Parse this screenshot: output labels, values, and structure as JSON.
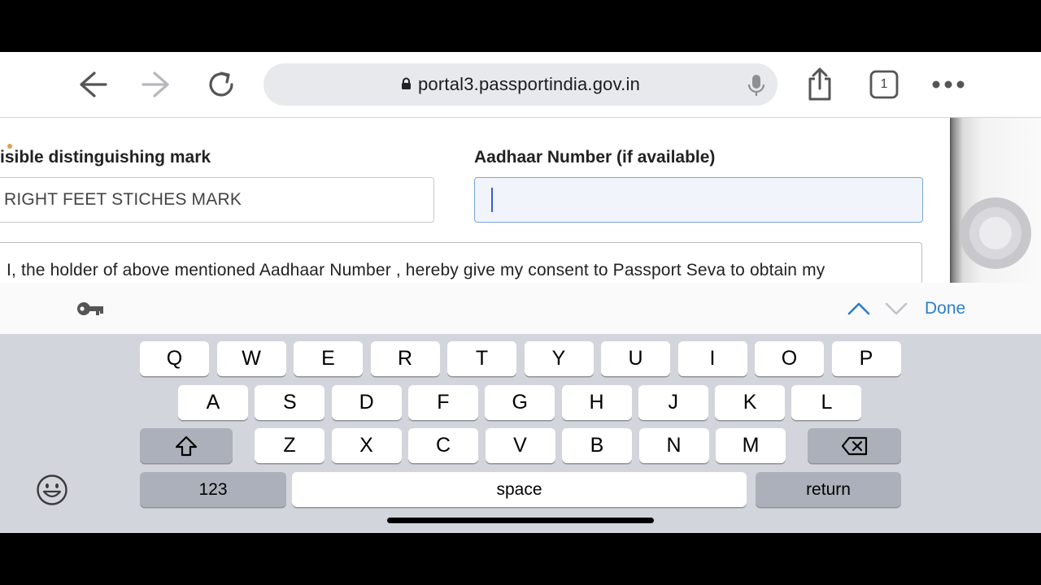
{
  "browser": {
    "url": "portal3.passportindia.gov.in",
    "tab_count": "1",
    "icons": [
      "back-arrow-icon",
      "forward-arrow-icon",
      "reload-icon",
      "lock-icon",
      "microphone-icon",
      "share-icon",
      "tabs-icon",
      "more-icon"
    ]
  },
  "form": {
    "mark_label": "isible distinguishing mark",
    "mark_value": "RIGHT FEET STICHES MARK",
    "aadhaar_label": "Aadhaar Number (if available)",
    "aadhaar_value": "",
    "consent_text": "I, the holder of above mentioned Aadhaar Number , hereby give my consent to Passport Seva to obtain my"
  },
  "accessory": {
    "done_label": "Done"
  },
  "keyboard": {
    "row1": [
      "Q",
      "W",
      "E",
      "R",
      "T",
      "Y",
      "U",
      "I",
      "O",
      "P"
    ],
    "row2": [
      "A",
      "S",
      "D",
      "F",
      "G",
      "H",
      "J",
      "K",
      "L"
    ],
    "row3": [
      "Z",
      "X",
      "C",
      "V",
      "B",
      "N",
      "M"
    ],
    "numbers_label": "123",
    "space_label": "space",
    "return_label": "return"
  },
  "colors": {
    "accent": "#2b7fc8",
    "keyboard_bg": "#d2d5db",
    "caret": "#3b5bd6"
  }
}
